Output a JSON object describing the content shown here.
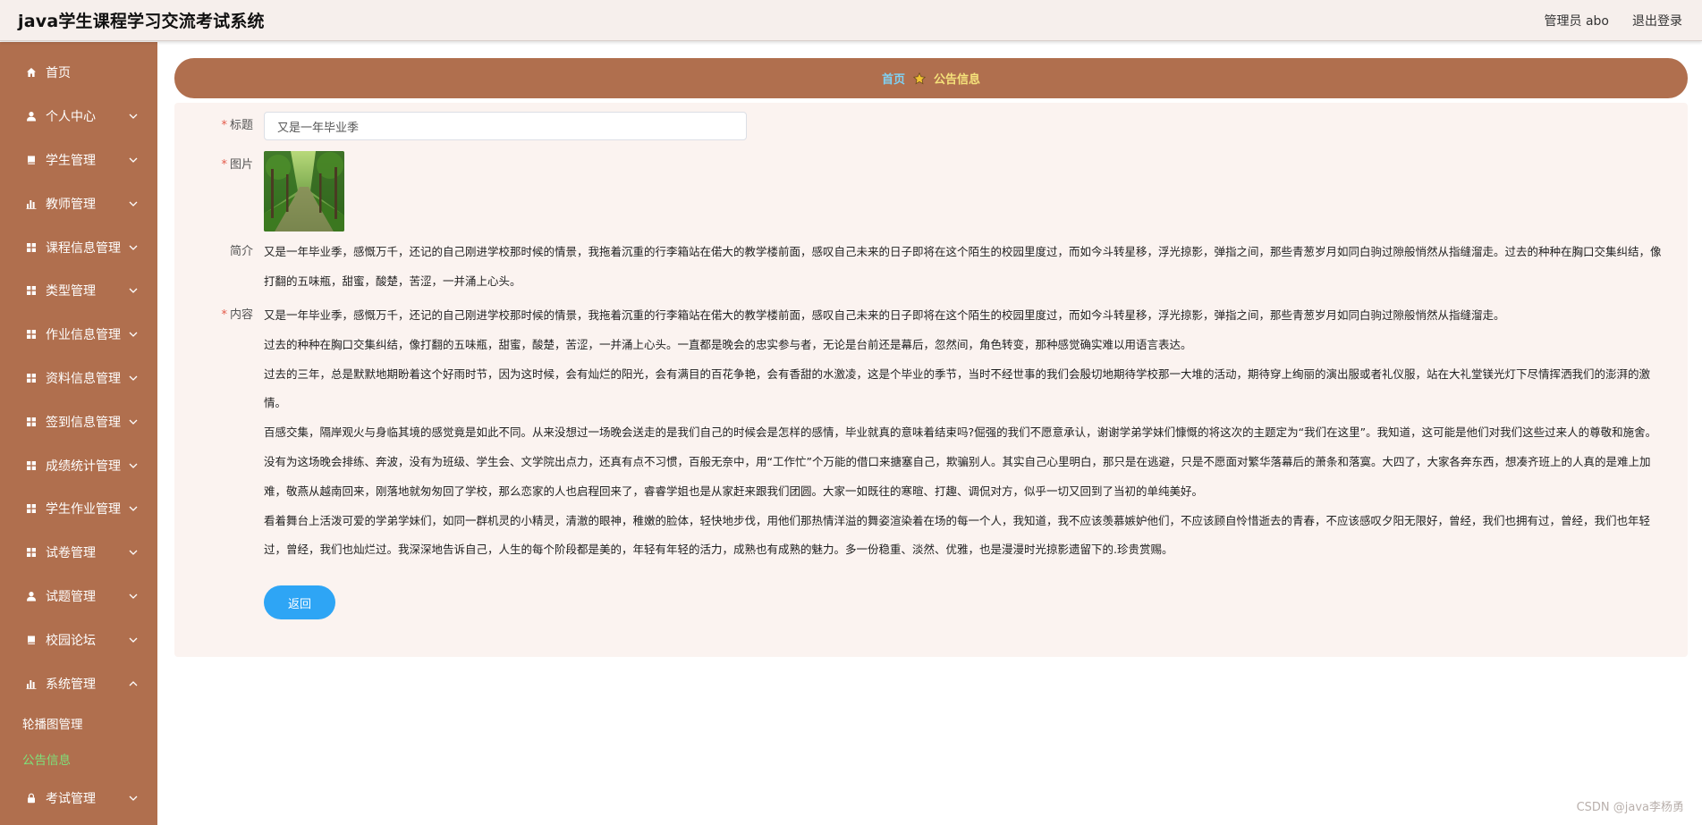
{
  "header": {
    "app_title": "java学生课程学习交流考试系统",
    "user_label": "管理员 abo",
    "logout_label": "退出登录"
  },
  "sidebar": {
    "items": [
      {
        "label": "首页",
        "icon": "home-icon",
        "has_children": false
      },
      {
        "label": "个人中心",
        "icon": "user-icon",
        "has_children": true
      },
      {
        "label": "学生管理",
        "icon": "book-icon",
        "has_children": true
      },
      {
        "label": "教师管理",
        "icon": "chart-icon",
        "has_children": true
      },
      {
        "label": "课程信息管理",
        "icon": "grid-icon",
        "has_children": true
      },
      {
        "label": "类型管理",
        "icon": "grid-icon",
        "has_children": true
      },
      {
        "label": "作业信息管理",
        "icon": "grid-icon",
        "has_children": true
      },
      {
        "label": "资料信息管理",
        "icon": "grid-icon",
        "has_children": true
      },
      {
        "label": "签到信息管理",
        "icon": "grid-icon",
        "has_children": true
      },
      {
        "label": "成绩统计管理",
        "icon": "grid-icon",
        "has_children": true
      },
      {
        "label": "学生作业管理",
        "icon": "grid-icon",
        "has_children": true
      },
      {
        "label": "试卷管理",
        "icon": "grid-icon",
        "has_children": true
      },
      {
        "label": "试题管理",
        "icon": "user-icon",
        "has_children": true
      },
      {
        "label": "校园论坛",
        "icon": "book-icon",
        "has_children": true
      },
      {
        "label": "系统管理",
        "icon": "chart-icon",
        "has_children": true
      }
    ],
    "system_submenu": [
      {
        "label": "轮播图管理",
        "active": false
      },
      {
        "label": "公告信息",
        "active": true
      }
    ],
    "last_item": {
      "label": "考试管理",
      "icon": "lock-icon",
      "has_children": true
    }
  },
  "breadcrumb": {
    "home": "首页",
    "current": "公告信息"
  },
  "form": {
    "title_label": "标题",
    "title_value": "又是一年毕业季",
    "image_label": "图片",
    "summary_label": "简介",
    "summary_text": "又是一年毕业季，感慨万千，还记的自己刚进学校那时候的情景，我拖着沉重的行李箱站在偌大的教学楼前面，感叹自己未来的日子即将在这个陌生的校园里度过，而如今斗转星移，浮光掠影，弹指之间，那些青葱岁月如同白驹过隙般悄然从指缝溜走。过去的种种在胸口交集纠结，像打翻的五味瓶，甜蜜，酸楚，苦涩，一并涌上心头。",
    "content_label": "内容",
    "content_paragraphs": [
      "又是一年毕业季，感慨万千，还记的自己刚进学校那时候的情景，我拖着沉重的行李箱站在偌大的教学楼前面，感叹自己未来的日子即将在这个陌生的校园里度过，而如今斗转星移，浮光掠影，弹指之间，那些青葱岁月如同白驹过隙般悄然从指缝溜走。",
      "过去的种种在胸口交集纠结，像打翻的五味瓶，甜蜜，酸楚，苦涩，一并涌上心头。一直都是晚会的忠实参与者，无论是台前还是幕后，忽然间，角色转变，那种感觉确实难以用语言表达。",
      "过去的三年，总是默默地期盼着这个好雨时节，因为这时候，会有灿烂的阳光，会有满目的百花争艳，会有香甜的水激凌，这是个毕业的季节，当时不经世事的我们会殷切地期待学校那一大堆的活动，期待穿上绚丽的演出服或者礼仪服，站在大礼堂镁光灯下尽情挥洒我们的澎湃的激情。",
      "百感交集，隔岸观火与身临其境的感觉竟是如此不同。从来没想过一场晚会送走的是我们自己的时候会是怎样的感情，毕业就真的意味着结束吗?倔强的我们不愿意承认，谢谢学弟学妹们慷慨的将这次的主题定为“我们在这里”。我知道，这可能是他们对我们这些过来人的尊敬和施舍。",
      "没有为这场晚会排练、奔波，没有为班级、学生会、文学院出点力，还真有点不习惯，百般无奈中，用“工作忙”个万能的借口来搪塞自己，欺骗别人。其实自己心里明白，那只是在逃避，只是不愿面对繁华落幕后的萧条和落寞。大四了，大家各奔东西，想凑齐班上的人真的是难上加难，敬燕从越南回来，刚落地就匆匆回了学校，那么恋家的人也启程回来了，睿睿学姐也是从家赶来跟我们团圆。大家一如既往的寒暄、打趣、调侃对方，似乎一切又回到了当初的单纯美好。",
      "看着舞台上活泼可爱的学弟学妹们，如同一群机灵的小精灵，清澈的眼神，稚嫩的脸体，轻快地步伐，用他们那热情洋溢的舞姿渲染着在场的每一个人，我知道，我不应该羡慕嫉妒他们，不应该顾自怜惜逝去的青春，不应该感叹夕阳无限好，曾经，我们也拥有过，曾经，我们也年轻过，曾经，我们也灿烂过。我深深地告诉自己，人生的每个阶段都是美的，年轻有年轻的活力，成熟也有成熟的魅力。多一份稳重、淡然、优雅，也是漫漫时光掠影遗留下的.珍贵赏赐。"
    ],
    "back_label": "返回"
  },
  "watermark": "CSDN @java李杨勇",
  "colors": {
    "sidebar_bg": "#b06f4e",
    "topbar_bg": "#f6efec",
    "panel_bg": "#fbf3f0",
    "primary_button": "#2ea5f5",
    "breadcrumb_home": "#7fd2f5",
    "breadcrumb_current": "#f5e27a",
    "active_submenu": "#7ee07a"
  }
}
